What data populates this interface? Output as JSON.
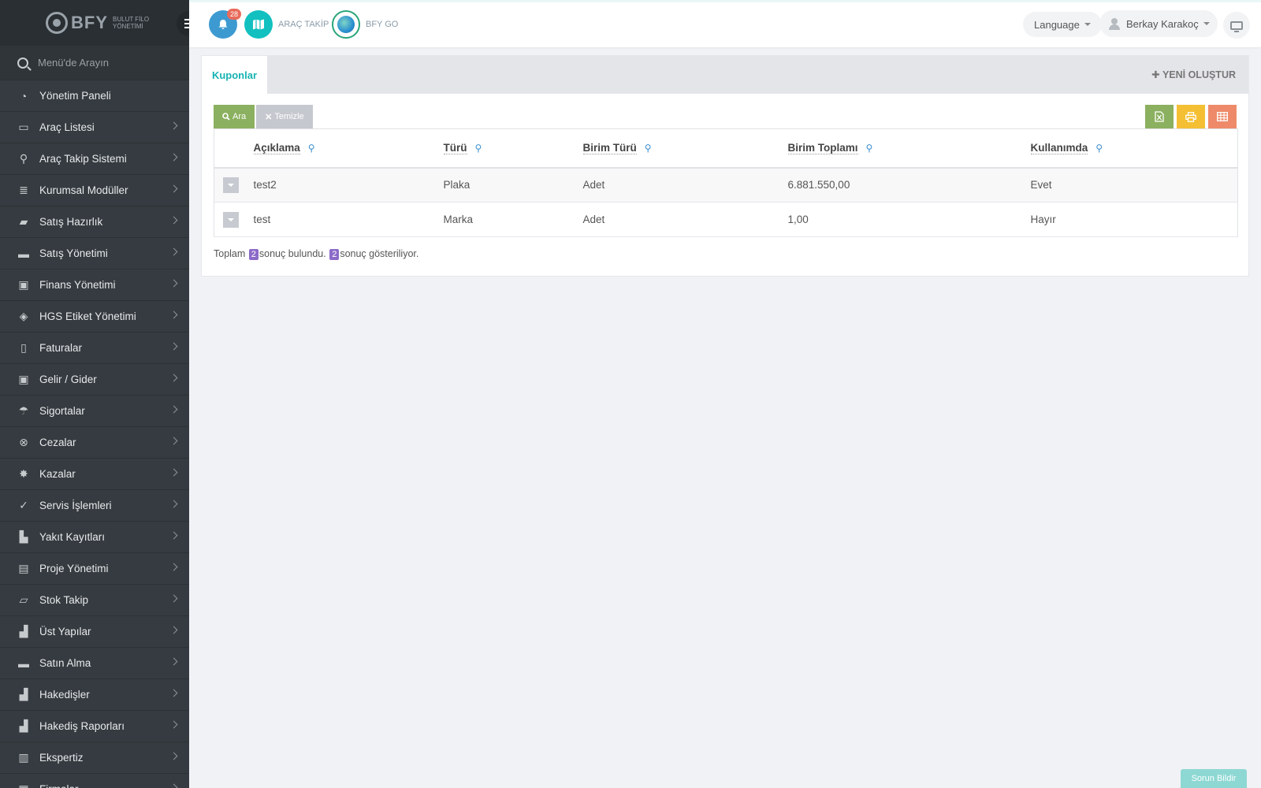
{
  "brand": {
    "name": "BFY",
    "subtitle": "BULUT FİLO YÖNETİMİ"
  },
  "sidebar": {
    "search_placeholder": "Menü'de Arayın",
    "items": [
      {
        "label": "Yönetim Paneli",
        "icon": "dashboard-icon",
        "chevron": false
      },
      {
        "label": "Araç Listesi",
        "icon": "bus-icon",
        "chevron": true
      },
      {
        "label": "Araç Takip Sistemi",
        "icon": "map-pin-icon",
        "chevron": true
      },
      {
        "label": "Kurumsal Modüller",
        "icon": "server-icon",
        "chevron": true
      },
      {
        "label": "Satış Hazırlık",
        "icon": "book-icon",
        "chevron": true
      },
      {
        "label": "Satış Yönetimi",
        "icon": "credit-card-icon",
        "chevron": true
      },
      {
        "label": "Finans Yönetimi",
        "icon": "money-icon",
        "chevron": true
      },
      {
        "label": "HGS Etiket Yönetimi",
        "icon": "tag-icon",
        "chevron": true
      },
      {
        "label": "Faturalar",
        "icon": "file-icon",
        "chevron": true
      },
      {
        "label": "Gelir / Gider",
        "icon": "money-icon",
        "chevron": true
      },
      {
        "label": "Sigortalar",
        "icon": "umbrella-icon",
        "chevron": true
      },
      {
        "label": "Cezalar",
        "icon": "times-circle-icon",
        "chevron": true
      },
      {
        "label": "Kazalar",
        "icon": "crash-icon",
        "chevron": true
      },
      {
        "label": "Servis İşlemleri",
        "icon": "check-circle-icon",
        "chevron": true
      },
      {
        "label": "Yakıt Kayıtları",
        "icon": "fuel-icon",
        "chevron": true
      },
      {
        "label": "Proje Yönetimi",
        "icon": "briefcase-icon",
        "chevron": true
      },
      {
        "label": "Stok Takip",
        "icon": "inbox-icon",
        "chevron": true
      },
      {
        "label": "Üst Yapılar",
        "icon": "truck-icon",
        "chevron": true
      },
      {
        "label": "Satın Alma",
        "icon": "credit-card-icon",
        "chevron": true
      },
      {
        "label": "Hakedişler",
        "icon": "truck-icon",
        "chevron": true
      },
      {
        "label": "Hakediş Raporları",
        "icon": "truck-icon",
        "chevron": true
      },
      {
        "label": "Ekspertiz",
        "icon": "report-icon",
        "chevron": true
      },
      {
        "label": "Firmalar",
        "icon": "building-icon",
        "chevron": true
      }
    ]
  },
  "topbar": {
    "notification_count": "28",
    "arac_takip_label": "ARAÇ TAKİP",
    "bfy_go_label": "BFY GO",
    "language_label": "Language",
    "user_name": "Berkay Karakoç"
  },
  "panel": {
    "tab_label": "Kuponlar",
    "new_button": "YENİ OLUŞTUR",
    "search_button": "Ara",
    "clear_button": "Temizle",
    "columns": [
      "Açıklama",
      "Türü",
      "Birim Türü",
      "Birim Toplamı",
      "Kullanımda"
    ],
    "rows": [
      [
        "test2",
        "Plaka",
        "Adet",
        "6.881.550,00",
        "Evet"
      ],
      [
        "test",
        "Marka",
        "Adet",
        "1,00",
        "Hayır"
      ]
    ],
    "summary": {
      "prefix": "Toplam",
      "total": "2",
      "found_text": "sonuç bulundu.",
      "shown": "2",
      "shown_text": "sonuç gösteriliyor."
    }
  },
  "report_button": "Sorun Bildir"
}
